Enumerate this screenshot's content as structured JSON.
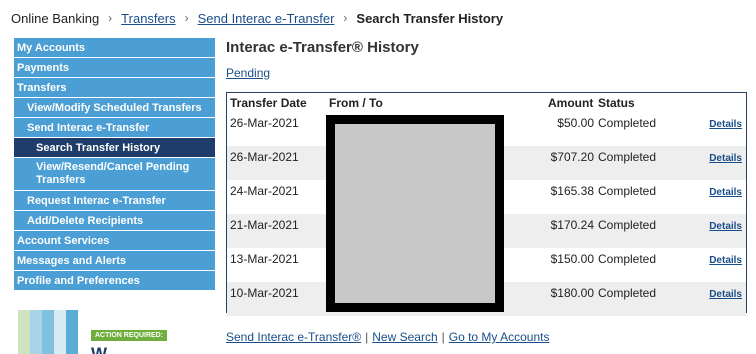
{
  "breadcrumb": {
    "items": [
      {
        "label": "Online Banking",
        "type": "plain"
      },
      {
        "label": "Transfers",
        "type": "link"
      },
      {
        "label": "Send Interac e-Transfer",
        "type": "link"
      },
      {
        "label": "Search Transfer History",
        "type": "current"
      }
    ],
    "separator": "›"
  },
  "nav": {
    "items": [
      {
        "label": "My Accounts",
        "level": 1
      },
      {
        "label": "Payments",
        "level": 1
      },
      {
        "label": "Transfers",
        "level": 1
      },
      {
        "label": "View/Modify Scheduled Transfers",
        "level": 2
      },
      {
        "label": "Send Interac e-Transfer",
        "level": 2
      },
      {
        "label": "Search Transfer History",
        "level": 3,
        "active": true
      },
      {
        "label": "View/Resend/Cancel Pending Transfers",
        "level": 3
      },
      {
        "label": "Request Interac e-Transfer",
        "level": 2
      },
      {
        "label": "Add/Delete Recipients",
        "level": 2
      },
      {
        "label": "Account Services",
        "level": 1
      },
      {
        "label": "Messages and Alerts",
        "level": 1
      },
      {
        "label": "Profile and Preferences",
        "level": 1
      }
    ]
  },
  "ad": {
    "badge": "ACTION REQUIRED:",
    "headline": "W...",
    "colors": [
      "#cfe3c0",
      "#a9d3e6",
      "#7fc1de",
      "#d7ecf3",
      "#5aaed6"
    ]
  },
  "main": {
    "title": "Interac e-Transfer® History",
    "pending_link": "Pending"
  },
  "table": {
    "headers": {
      "date": "Transfer Date",
      "from_to": "From / To",
      "amount": "Amount",
      "status": "Status"
    },
    "rows": [
      {
        "date": "26-Mar-2021",
        "amount": "$50.00",
        "status": "Completed",
        "details": "Details"
      },
      {
        "date": "26-Mar-2021",
        "amount": "$707.20",
        "status": "Completed",
        "details": "Details"
      },
      {
        "date": "24-Mar-2021",
        "amount": "$165.38",
        "status": "Completed",
        "details": "Details"
      },
      {
        "date": "21-Mar-2021",
        "amount": "$170.24",
        "status": "Completed",
        "details": "Details"
      },
      {
        "date": "13-Mar-2021",
        "amount": "$150.00",
        "status": "Completed",
        "details": "Details"
      },
      {
        "date": "10-Mar-2021",
        "amount": "$180.00",
        "status": "Completed",
        "details": "Details"
      }
    ]
  },
  "footer": {
    "links": [
      "Send Interac e-Transfer®",
      "New Search",
      "Go to My Accounts"
    ],
    "separator": "|"
  },
  "colors": {
    "nav_bg": "#4b9fd4",
    "nav_active": "#1e3d6b",
    "link": "#1a4e8a",
    "table_border": "#2a3f66",
    "row_alt": "#eeeeee"
  }
}
